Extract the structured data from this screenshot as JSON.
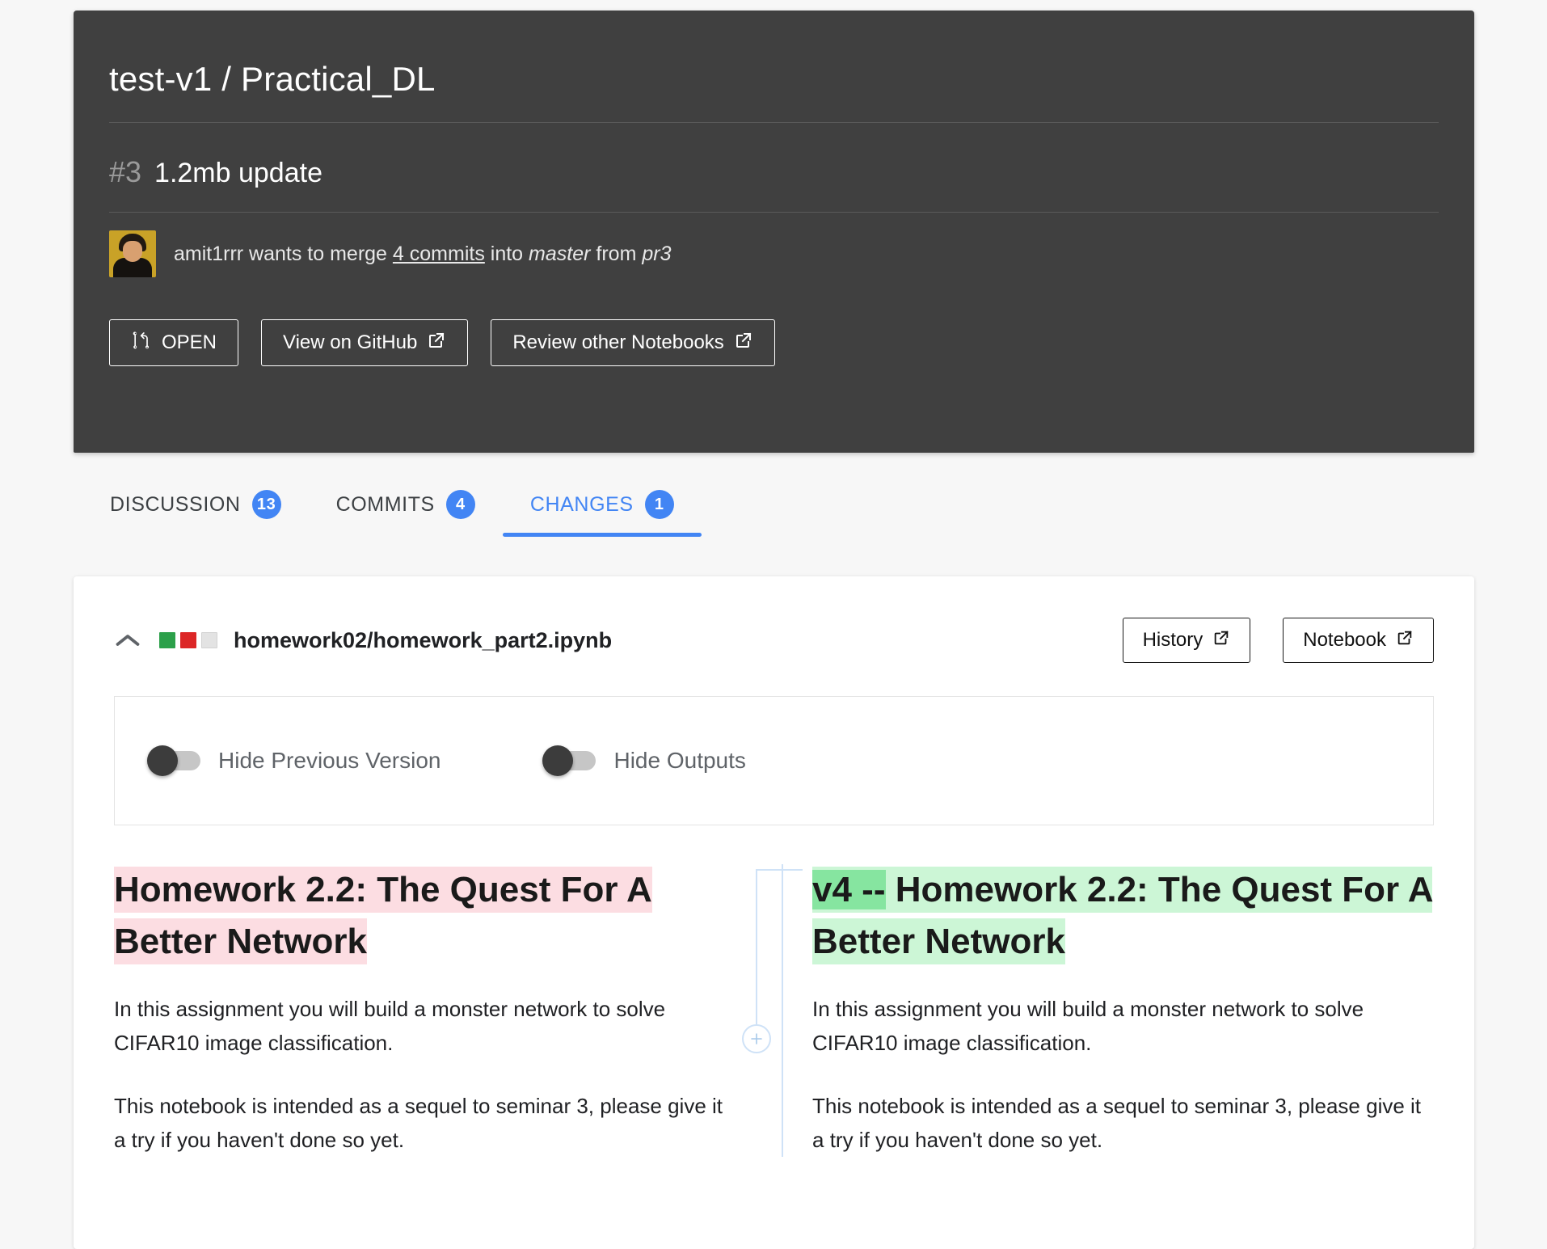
{
  "header": {
    "repo": "test-v1 / Practical_DL",
    "pr_number": "#3",
    "pr_title": "1.2mb update",
    "merge_author": "amit1rrr",
    "merge_pre": "amit1rrr wants to merge",
    "merge_commits_link": "4 commits",
    "merge_mid": "into",
    "merge_base": "master",
    "merge_from_word": "from",
    "merge_head": "pr3",
    "buttons": {
      "status_label": "OPEN",
      "github_label": "View on GitHub",
      "review_label": "Review other Notebooks"
    }
  },
  "tabs": [
    {
      "label": "DISCUSSION",
      "count": "13",
      "active": false
    },
    {
      "label": "COMMITS",
      "count": "4",
      "active": false
    },
    {
      "label": "CHANGES",
      "count": "1",
      "active": true
    }
  ],
  "file": {
    "path": "homework02/homework_part2.ipynb",
    "history_label": "History",
    "notebook_label": "Notebook"
  },
  "options": {
    "hide_previous_label": "Hide Previous Version",
    "hide_previous_on": false,
    "hide_outputs_label": "Hide Outputs",
    "hide_outputs_on": false
  },
  "diff": {
    "left": {
      "heading": "Homework 2.2: The Quest For A Better Network",
      "paragraph1": "In this assignment you will build a monster network to solve CIFAR10 image classification.",
      "paragraph2": "This notebook is intended as a sequel to seminar 3, please give it a try if you haven't done so yet."
    },
    "right": {
      "heading_added_word": "v4 --",
      "heading_rest": " Homework 2.2: The Quest For A Better Network",
      "paragraph1": "In this assignment you will build a monster network to solve CIFAR10 image classification.",
      "paragraph2": "This notebook is intended as a sequel to seminar 3, please give it a try if you haven't done so yet."
    },
    "add_comment_icon": "plus-circle-icon"
  },
  "colors": {
    "accent": "#4285f4",
    "header_bg": "#404040",
    "diff_added_line": "#ccf6d6",
    "diff_added_word": "#86e5a0",
    "diff_removed_line": "#fcdde2",
    "stat_added": "#2ca04a",
    "stat_removed": "#dc2626",
    "stat_neutral": "#e3e3e3"
  }
}
